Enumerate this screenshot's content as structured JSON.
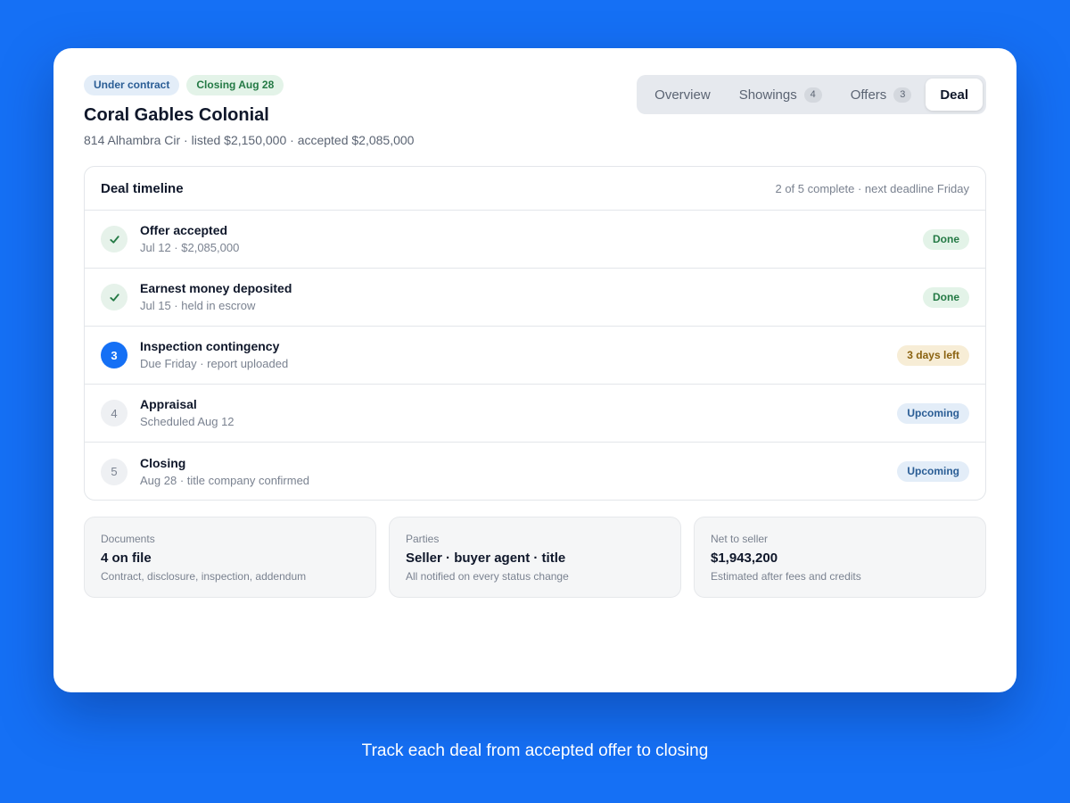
{
  "header": {
    "badges": [
      "Under contract",
      "Closing Aug 28"
    ],
    "title": "Coral Gables Colonial",
    "subtitle": "814 Alhambra Cir · listed $2,150,000 · accepted $2,085,000"
  },
  "tabs": [
    {
      "label": "Overview",
      "count": null,
      "active": false
    },
    {
      "label": "Showings",
      "count": "4",
      "active": false
    },
    {
      "label": "Offers",
      "count": "3",
      "active": false
    },
    {
      "label": "Deal",
      "count": null,
      "active": true
    }
  ],
  "timeline": {
    "heading": "Deal timeline",
    "summary": "2 of 5 complete · next deadline Friday",
    "steps": [
      {
        "marker": "check-icon",
        "title": "Offer accepted",
        "sub": "Jul 12 · $2,085,000",
        "status": "Done"
      },
      {
        "marker": "check-icon",
        "title": "Earnest money deposited",
        "sub": "Jul 15 · held in escrow",
        "status": "Done"
      },
      {
        "marker": "3",
        "title": "Inspection contingency",
        "sub": "Due Friday · report uploaded",
        "status": "3 days left"
      },
      {
        "marker": "4",
        "title": "Appraisal",
        "sub": "Scheduled Aug 12",
        "status": "Upcoming"
      },
      {
        "marker": "5",
        "title": "Closing",
        "sub": "Aug 28 · title company confirmed",
        "status": "Upcoming"
      }
    ]
  },
  "cards": [
    {
      "label": "Documents",
      "value": "4 on file",
      "desc": "Contract, disclosure, inspection, addendum"
    },
    {
      "label": "Parties",
      "value": "Seller · buyer agent · title",
      "desc": "All notified on every status change"
    },
    {
      "label": "Net to seller",
      "value": "$1,943,200",
      "desc": "Estimated after fees and credits"
    }
  ],
  "caption": "Track each deal from accepted offer to closing",
  "colors": {
    "accent": "#1570f5",
    "done": "#247a45",
    "warning": "#8a6210",
    "upcoming": "#2a5d95"
  }
}
